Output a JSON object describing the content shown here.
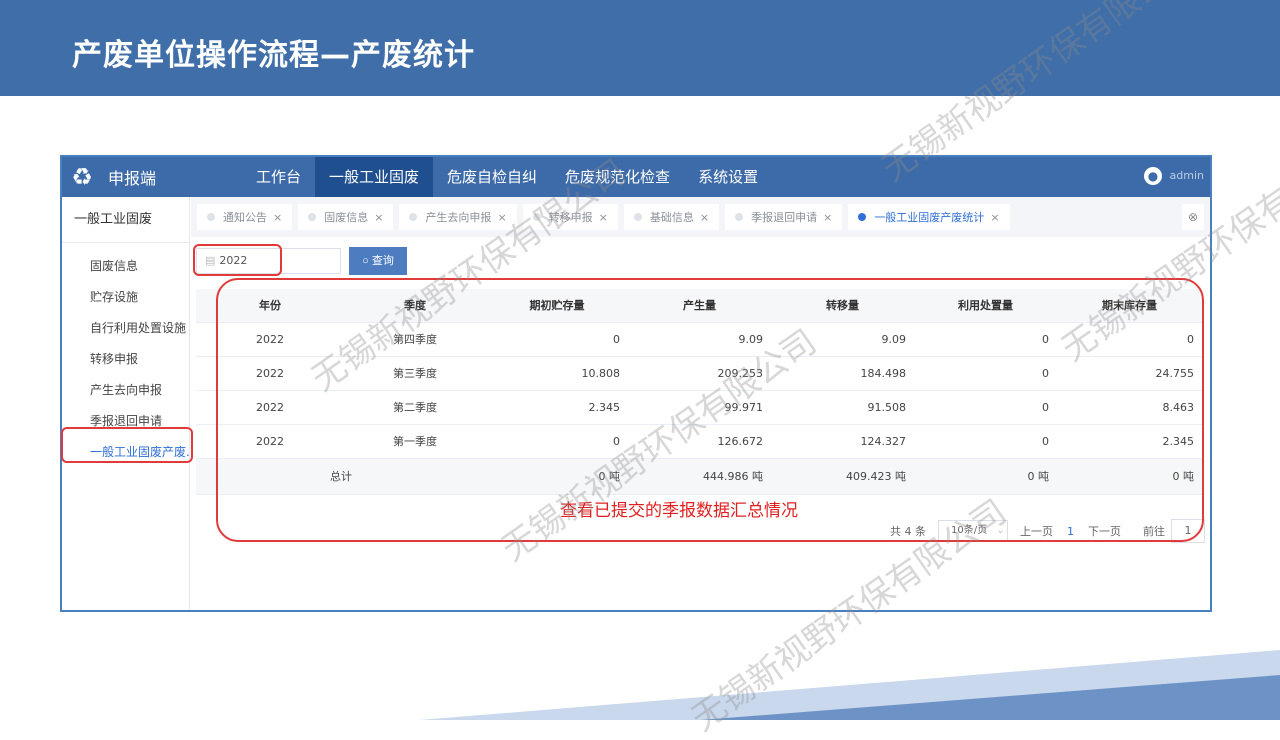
{
  "slide": {
    "title": "产废单位操作流程—产废统计",
    "note": "查看已提交的季报数据汇总情况"
  },
  "app": {
    "name": "申报端",
    "user": "admin",
    "topnav": [
      "工作台",
      "一般工业固废",
      "危废自检自纠",
      "危废规范化检查",
      "系统设置"
    ],
    "active_topnav": 1
  },
  "sidebar": {
    "title": "一般工业固废",
    "items": [
      "固废信息",
      "贮存设施",
      "自行利用处置设施",
      "转移申报",
      "产生去向申报",
      "季报退回申请",
      "一般工业固废产废..."
    ],
    "active_index": 6
  },
  "tabs": [
    {
      "label": "通知公告",
      "active": false
    },
    {
      "label": "固废信息",
      "active": false
    },
    {
      "label": "产生去向申报",
      "active": false
    },
    {
      "label": "转移申报",
      "active": false
    },
    {
      "label": "基础信息",
      "active": false
    },
    {
      "label": "季报退回申请",
      "active": false
    },
    {
      "label": "一般工业固废产废统计",
      "active": true
    }
  ],
  "filter": {
    "year": "2022",
    "query_label": "查询"
  },
  "table": {
    "columns": [
      "年份",
      "季度",
      "期初贮存量",
      "产生量",
      "转移量",
      "利用处置量",
      "期末库存量"
    ],
    "rows": [
      [
        "2022",
        "第四季度",
        "0",
        "9.09",
        "9.09",
        "0",
        "0"
      ],
      [
        "2022",
        "第三季度",
        "10.808",
        "209.253",
        "184.498",
        "0",
        "24.755"
      ],
      [
        "2022",
        "第二季度",
        "2.345",
        "99.971",
        "91.508",
        "0",
        "8.463"
      ],
      [
        "2022",
        "第一季度",
        "0",
        "126.672",
        "124.327",
        "0",
        "2.345"
      ]
    ],
    "total": [
      "总计",
      "0 吨",
      "444.986 吨",
      "409.423 吨",
      "0 吨",
      "0 吨"
    ]
  },
  "pagination": {
    "total": "共 4 条",
    "page_size": "10条/页",
    "prev": "上一页",
    "current": "1",
    "next": "下一页",
    "goto_label": "前往",
    "goto_value": "1",
    "page_unit": "页"
  },
  "watermark": "无锡新视野环保有限公司",
  "colors": {
    "header": "#3f6ea8",
    "nav_active": "#1f4f8f",
    "accent": "#2f6fd6",
    "annotation": "#e03a3a"
  }
}
